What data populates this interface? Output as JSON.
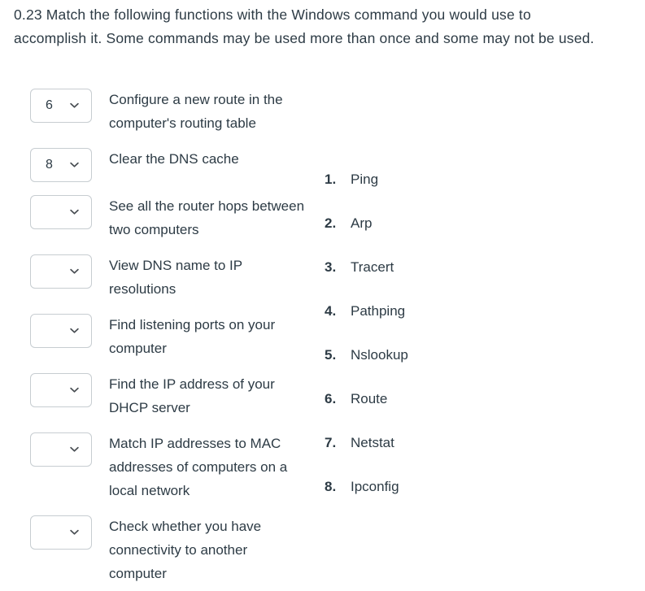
{
  "question": {
    "number": "0.23",
    "text": "0.23 Match the following functions with the Windows command you would use to accomplish it. Some commands may be used more than once and some may not be used."
  },
  "colors": {
    "text": "#2d3b45",
    "border": "#c7cdd1",
    "background": "#ffffff"
  },
  "match_rows": [
    {
      "selected": "6",
      "chevron_icon": "chevron-down-icon",
      "prompt": "Configure a new route in the computer's routing table"
    },
    {
      "selected": "8",
      "chevron_icon": "chevron-down-icon",
      "prompt": "Clear the DNS cache"
    },
    {
      "selected": "",
      "chevron_icon": "chevron-down-icon",
      "prompt": "See all the router hops between two computers"
    },
    {
      "selected": "",
      "chevron_icon": "chevron-down-icon",
      "prompt": "View DNS name to IP resolutions"
    },
    {
      "selected": "",
      "chevron_icon": "chevron-down-icon",
      "prompt": "Find listening ports on your computer"
    },
    {
      "selected": "",
      "chevron_icon": "chevron-down-icon",
      "prompt": "Find the IP address of your DHCP server"
    },
    {
      "selected": "",
      "chevron_icon": "chevron-down-icon",
      "prompt": "Match IP addresses to MAC addresses of computers on a local network"
    },
    {
      "selected": "",
      "chevron_icon": "chevron-down-icon",
      "prompt": "Check whether you have connectivity to another computer"
    }
  ],
  "answer_options": [
    {
      "number": "1.",
      "label": "Ping"
    },
    {
      "number": "2.",
      "label": "Arp"
    },
    {
      "number": "3.",
      "label": "Tracert"
    },
    {
      "number": "4.",
      "label": "Pathping"
    },
    {
      "number": "5.",
      "label": "Nslookup"
    },
    {
      "number": "6.",
      "label": "Route"
    },
    {
      "number": "7.",
      "label": "Netstat"
    },
    {
      "number": "8.",
      "label": "Ipconfig"
    }
  ]
}
